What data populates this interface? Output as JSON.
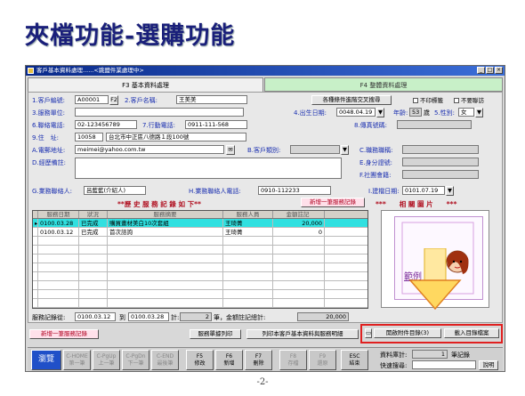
{
  "slide": {
    "title": "夾檔功能-選購功能",
    "page": "-2-"
  },
  "window": {
    "title": "客戶基本資料處理......<跳鹽件業處理中>"
  },
  "tabs": {
    "active": "F3 基本資料處理",
    "other": "F4 整體資料處理"
  },
  "form": {
    "customer_id_label": "1.客戶編號:",
    "customer_id": "A00001",
    "f2": "F2",
    "customer_name_label": "2.客戶名稱:",
    "customer_name": "王美美",
    "search_cond_btn": "各種條件進階交叉搜尋",
    "chk_no_mail": "不印標籤",
    "chk_no_visit": "不要聯訪",
    "service_unit_label": "3.服務單位:",
    "birth_label": "4.出生日期:",
    "birth": "0048.04.19",
    "age_label": "年齡:",
    "age": "53",
    "age_unit": "歲",
    "gender_label": "5.性別:",
    "gender": "女",
    "phone_label": "6.聯絡電話:",
    "phone": "02-123456789",
    "mobile_label": "7.行動電話:",
    "mobile": "0911-111-568",
    "fax_label": "8.傳真號碼:",
    "addr_label": "9.住　址:",
    "zip": "10058",
    "addr": "台北市中正區八德路１段100號",
    "email_label": "A.電郵地址:",
    "email": "meimei@yahoo.com.tw",
    "category_label": "B.客戶類別:",
    "remark_label": "D.經歷備註:",
    "job_label": "C.職務職稱:",
    "id_label": "E.身分證號:",
    "social_label": "F.社團會籍:",
    "agent_label": "G.業務聯絡人:",
    "agent": "呂藍藍(介紹人)",
    "agent_phone_label": "H.業務聯絡人電話:",
    "agent_phone": "0910-112233",
    "build_date_label": "I.建檔日期:",
    "build_date": "0101.07.19"
  },
  "history": {
    "title": "**歷 史 服 務 記 錄 如 下**",
    "add_btn": "新增一筆服務記錄",
    "photo_title": "***　　相 關 圖 片　　***",
    "headers": [
      "服務日期",
      "狀況",
      "服務摘要",
      "服務人員",
      "金額註記"
    ],
    "rows": [
      [
        "0100.03.28",
        "已完成",
        "購買畫材美白10次套組",
        "王琦菁",
        "20,000"
      ],
      [
        "0100.03.12",
        "已完成",
        "首次諮詢",
        "王琦菁",
        "0"
      ]
    ],
    "range_label": "服務記錄從:",
    "range_from": "0100.03.12",
    "range_to_label": "到",
    "range_to": "0100.03.28",
    "count_label": "計:",
    "count": "2",
    "count_unit": "筆，金額註記總計:",
    "total": "20,000"
  },
  "actions": {
    "add_record": "新增一筆服務記錄",
    "print_list": "服務單據列印",
    "print_all": "列印本客戶基本資料與服務明細",
    "open_attach": "開啟附件目錄(3)",
    "load_attach": "載入目錄檔案"
  },
  "photo": {
    "sample": "範例"
  },
  "toolbar": {
    "buttons": [
      {
        "label": "瀏覽",
        "sub": ""
      },
      {
        "label": "C-HOME",
        "sub": "第一筆"
      },
      {
        "label": "C-PgUp",
        "sub": "上一筆"
      },
      {
        "label": "C-PgDn",
        "sub": "下一筆"
      },
      {
        "label": "C-END",
        "sub": "最後筆"
      },
      {
        "label": "F5",
        "sub": "修改"
      },
      {
        "label": "F6",
        "sub": "新增"
      },
      {
        "label": "F7",
        "sub": "刪除"
      },
      {
        "label": "F8",
        "sub": "存檔"
      },
      {
        "label": "F9",
        "sub": "還原"
      },
      {
        "label": "ESC",
        "sub": "結束"
      }
    ],
    "record_total_label": "資料庫計:",
    "record_total": "1",
    "record_unit": "筆記錄",
    "quick_search_label": "快速搜尋:",
    "help_btn": "說明"
  }
}
